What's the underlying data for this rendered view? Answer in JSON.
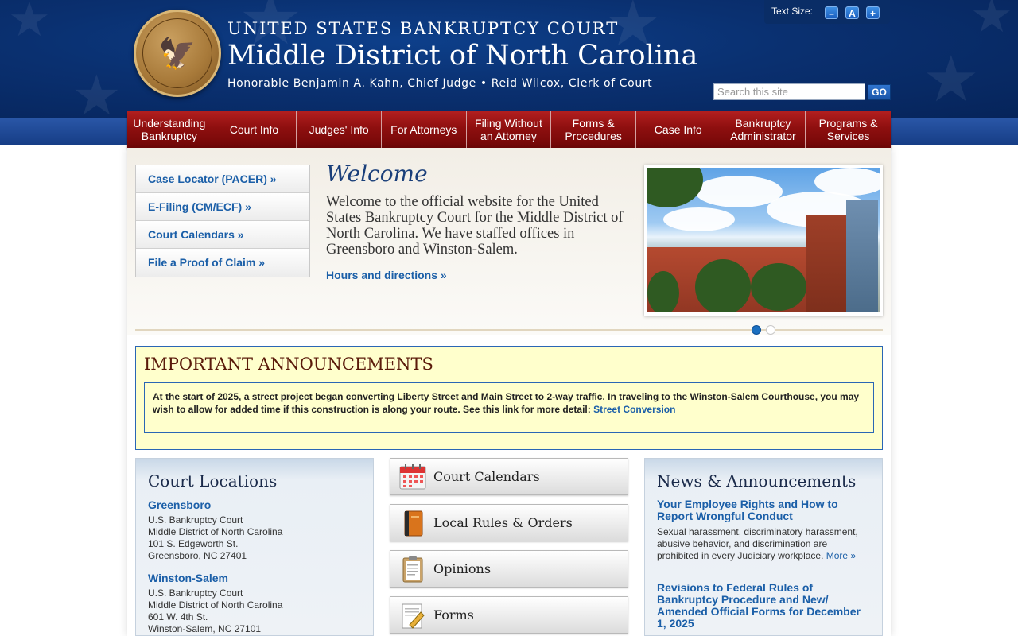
{
  "header": {
    "court_line1": "UNITED STATES BANKRUPTCY COURT",
    "court_line2": "Middle District of North Carolina",
    "court_line3": "Honorable Benjamin A. Kahn, Chief Judge • Reid Wilcox, Clerk of Court",
    "seal_icon": "court-seal",
    "text_size_label": "Text Size:",
    "text_size_decrease": "–",
    "text_size_reset": "A",
    "text_size_increase": "+",
    "search_placeholder": "Search this site",
    "search_button": "GO"
  },
  "nav": {
    "items": [
      {
        "label": "Understanding Bankruptcy"
      },
      {
        "label": "Court Info"
      },
      {
        "label": "Judges' Info"
      },
      {
        "label": "For Attorneys"
      },
      {
        "label": "Filing Without an Attorney"
      },
      {
        "label": "Forms & Procedures"
      },
      {
        "label": "Case Info"
      },
      {
        "label": "Bankruptcy Administrator"
      },
      {
        "label": "Programs & Services"
      }
    ]
  },
  "quick_links": [
    {
      "label": "Case Locator (PACER) »"
    },
    {
      "label": "E-Filing (CM/ECF) »"
    },
    {
      "label": "Court Calendars »"
    },
    {
      "label": "File a Proof of Claim »"
    }
  ],
  "welcome": {
    "title": "Welcome",
    "text": "Welcome to the official website for the United States Bankruptcy Court for the Middle District of North Carolina. We have staffed offices in Greensboro and Winston-Salem.",
    "hours_link": "Hours and directions »"
  },
  "slider": {
    "active_index": 0,
    "count": 2,
    "active_color": "#1b6fc0"
  },
  "announcements": {
    "title": "IMPORTANT ANNOUNCEMENTS",
    "text": "At the start of 2025, a street project began converting Liberty Street and Main Street to 2-way traffic. In traveling to the Winston-Salem Courthouse, you may wish to allow for added time if this construction is along your route. See this link for more detail: ",
    "link": "Street Conversion"
  },
  "locations": {
    "title": "Court Locations",
    "items": [
      {
        "name": "Greensboro",
        "lines": [
          "U.S. Bankruptcy Court",
          "Middle District of North Carolina",
          "101 S. Edgeworth St.",
          "Greensboro, NC  27401"
        ]
      },
      {
        "name": "Winston-Salem",
        "lines": [
          "U.S. Bankruptcy Court",
          "Middle District of North Carolina",
          "601 W. 4th St.",
          "Winston-Salem, NC  27101"
        ]
      }
    ]
  },
  "tiles": [
    {
      "label": "Court Calendars",
      "icon": "calendar-icon"
    },
    {
      "label": "Local Rules & Orders",
      "icon": "book-icon"
    },
    {
      "label": "Opinions",
      "icon": "clipboard-icon"
    },
    {
      "label": "Forms",
      "icon": "form-pencil-icon"
    }
  ],
  "news": {
    "title": "News & Announcements",
    "items": [
      {
        "title": "Your Employee Rights and How to Report Wrongful Conduct",
        "text": "Sexual harassment, discriminatory harassment, abusive behavior, and discrimination are prohibited in every Judiciary workplace. ",
        "more": "More »"
      },
      {
        "title": "Revisions to Federal Rules of Bankruptcy Procedure and New/ Amended Official Forms for December 1, 2025"
      }
    ]
  },
  "colors": {
    "header_blue": "#0a3070",
    "nav_red": "#8e0f0f",
    "link_blue": "#1b5fa8",
    "announcement_bg": "#ffffcc"
  }
}
